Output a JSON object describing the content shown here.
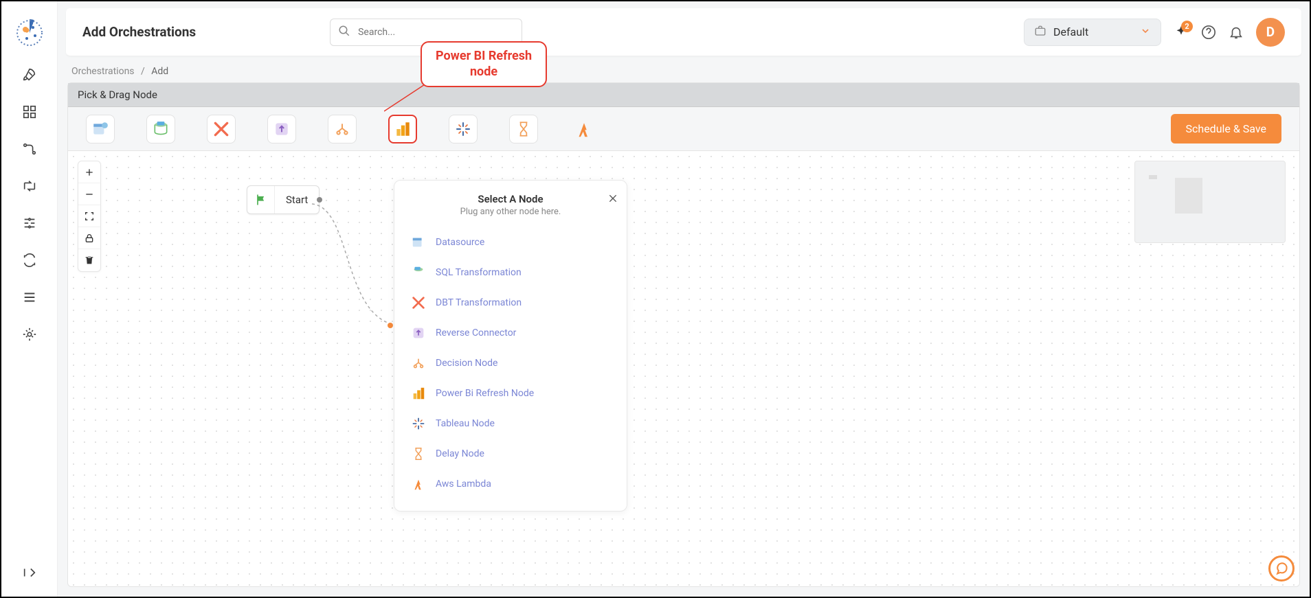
{
  "header": {
    "title": "Add Orchestrations",
    "search_placeholder": "Search...",
    "workspace": "Default",
    "notif_count": "2",
    "avatar_letter": "D"
  },
  "breadcrumb": {
    "parent": "Orchestrations",
    "current": "Add"
  },
  "palette": {
    "title": "Pick & Drag Node",
    "items": [
      {
        "name": "datasource"
      },
      {
        "name": "sql-transformation"
      },
      {
        "name": "dbt-transformation"
      },
      {
        "name": "reverse-connector"
      },
      {
        "name": "decision-node"
      },
      {
        "name": "power-bi-refresh"
      },
      {
        "name": "tableau-node"
      },
      {
        "name": "delay-node"
      },
      {
        "name": "aws-lambda"
      }
    ]
  },
  "schedule_button": "Schedule & Save",
  "callout_text_line1": "Power BI Refresh",
  "callout_text_line2": "node",
  "canvas": {
    "start_label": "Start"
  },
  "node_panel": {
    "title": "Select A Node",
    "subtitle": "Plug any other node here.",
    "options": [
      "Datasource",
      "SQL Transformation",
      "DBT Transformation",
      "Reverse Connector",
      "Decision Node",
      "Power Bi Refresh Node",
      "Tableau Node",
      "Delay Node",
      "Aws Lambda"
    ]
  }
}
